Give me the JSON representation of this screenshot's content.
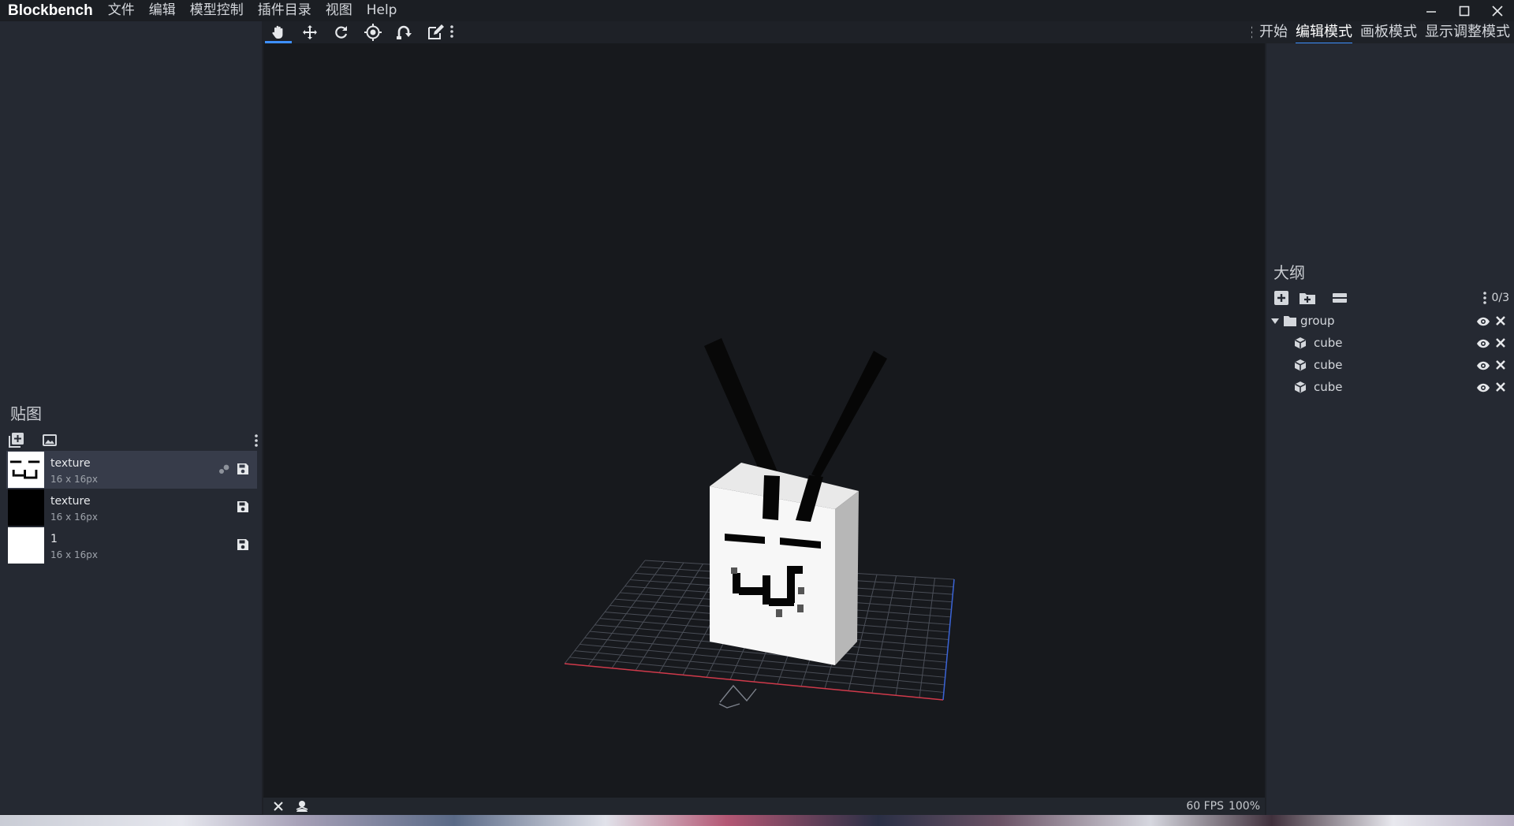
{
  "app": {
    "name": "Blockbench",
    "menu": [
      "文件",
      "编辑",
      "模型控制",
      "插件目录",
      "视图",
      "Help"
    ]
  },
  "modes": {
    "tabs": [
      "开始",
      "编辑模式",
      "画板模式",
      "显示调整模式"
    ],
    "active": "编辑模式"
  },
  "tools": [
    "move-view-icon",
    "move-icon",
    "rotate-icon",
    "pivot-icon",
    "vertex-snap-icon",
    "edit-icon"
  ],
  "textures_panel": {
    "title": "贴图",
    "items": [
      {
        "name": "texture",
        "size": "16 x 16px",
        "thumb": "face"
      },
      {
        "name": "texture",
        "size": "16 x 16px",
        "thumb": "black"
      },
      {
        "name": "1",
        "size": "16 x 16px",
        "thumb": "white"
      }
    ]
  },
  "outliner": {
    "title": "大纲",
    "count": "0/3",
    "nodes": [
      {
        "label": "group",
        "type": "group"
      },
      {
        "label": "cube",
        "type": "cube"
      },
      {
        "label": "cube",
        "type": "cube"
      },
      {
        "label": "cube",
        "type": "cube"
      }
    ]
  },
  "status": {
    "fps": "60 FPS",
    "zoom": "100%"
  },
  "colors": {
    "accent": "#3e90ff",
    "panel": "#252932",
    "viewport": "#17191d"
  }
}
